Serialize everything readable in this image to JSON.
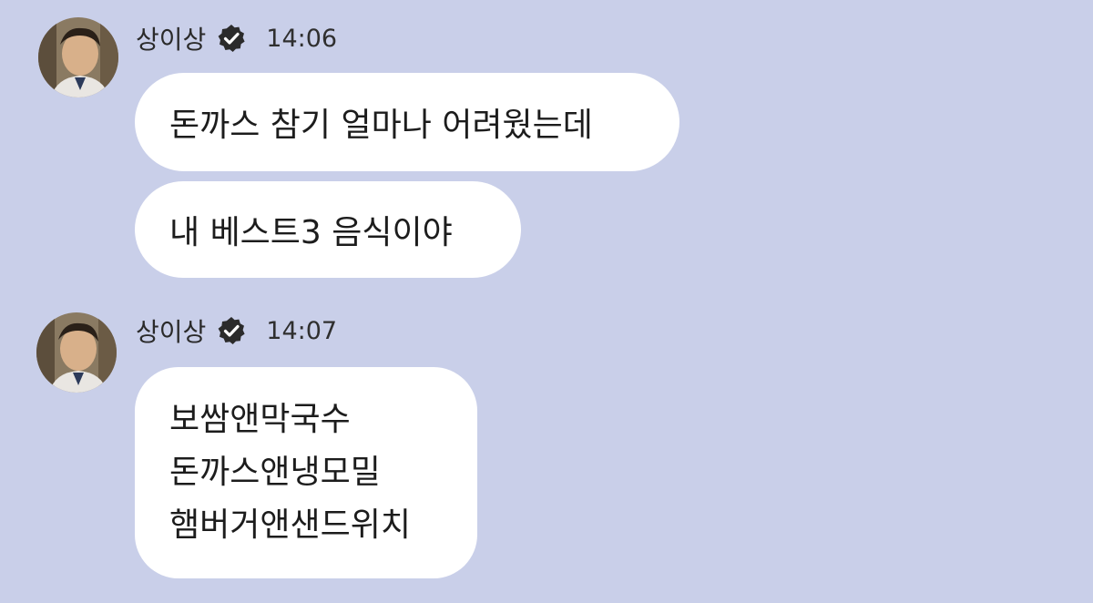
{
  "messages": [
    {
      "sender": "상이상",
      "verified": true,
      "time": "14:06",
      "bubbles": [
        {
          "text": "돈까스 참기 얼마나 어려웠는데"
        },
        {
          "text": "내 베스트3 음식이야"
        }
      ]
    },
    {
      "sender": "상이상",
      "verified": true,
      "time": "14:07",
      "bubbles": [
        {
          "lines": [
            "보쌈앤막국수",
            "돈까스앤냉모밀",
            "햄버거앤샌드위치"
          ]
        }
      ]
    }
  ],
  "colors": {
    "background": "#c9cfe9",
    "bubble": "#ffffff",
    "verified_badge": "#2b2b2b"
  },
  "icons": {
    "verified": "verified-badge-icon",
    "avatar": "profile-photo"
  }
}
